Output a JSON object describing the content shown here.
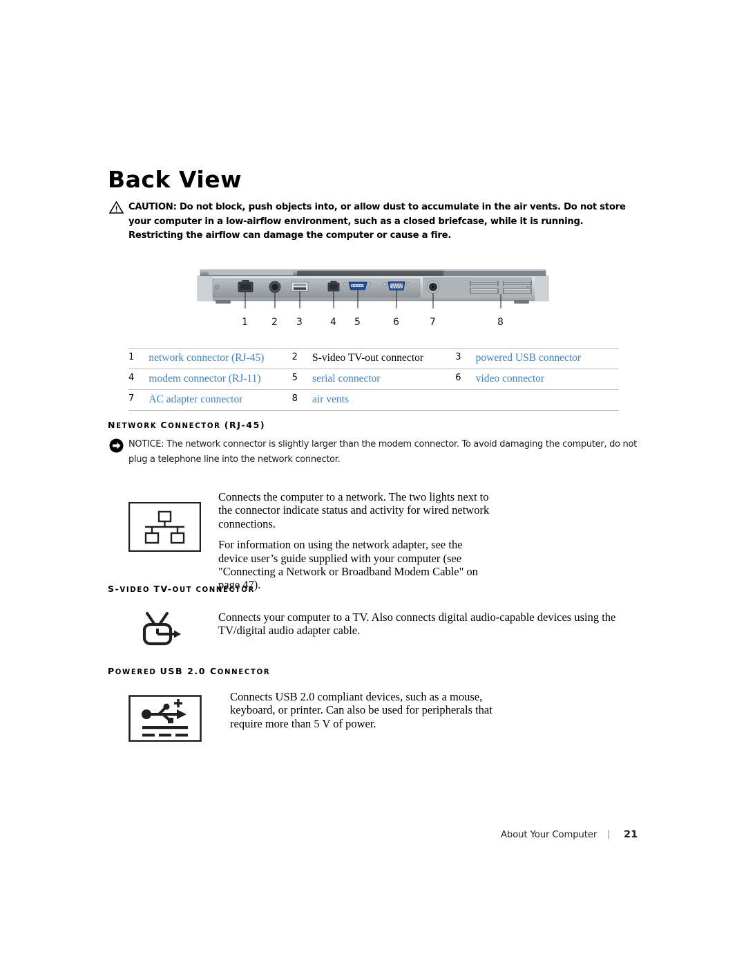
{
  "page": {
    "title": "Back View",
    "footer_section": "About Your Computer",
    "footer_separator": "|",
    "footer_page_number": "21"
  },
  "caution": {
    "icon": "warning-triangle-icon",
    "label": "CAUTION:",
    "text": "CAUTION: Do not block, push objects into, or allow dust to accumulate in the air vents. Do not store your computer in a low-airflow environment, such as a closed briefcase, while it is running. Restricting the airflow can damage the computer or cause a fire."
  },
  "illustration": {
    "name": "laptop-back-panel-photo",
    "callout_numbers": [
      "1",
      "2",
      "3",
      "4",
      "5",
      "6",
      "7",
      "8"
    ],
    "ports": [
      {
        "number": "1",
        "name": "network-port-rj45"
      },
      {
        "number": "2",
        "name": "s-video-port"
      },
      {
        "number": "3",
        "name": "usb-port"
      },
      {
        "number": "4",
        "name": "modem-port-rj11"
      },
      {
        "number": "5",
        "name": "serial-port-db9"
      },
      {
        "number": "6",
        "name": "video-port-vga"
      },
      {
        "number": "7",
        "name": "ac-adapter-jack"
      },
      {
        "number": "8",
        "name": "air-vents-grille"
      }
    ]
  },
  "legend": {
    "rows": [
      [
        {
          "num": "1",
          "label": "network connector (RJ-45)",
          "link": true
        },
        {
          "num": "2",
          "label": "S-video TV-out connector",
          "link": false
        },
        {
          "num": "3",
          "label": "powered USB connector",
          "link": true
        }
      ],
      [
        {
          "num": "4",
          "label": "modem connector (RJ-11)",
          "link": true
        },
        {
          "num": "5",
          "label": "serial connector",
          "link": true
        },
        {
          "num": "6",
          "label": "video connector",
          "link": true
        }
      ],
      [
        {
          "num": "7",
          "label": "AC adapter connector",
          "link": true
        },
        {
          "num": "8",
          "label": "air vents",
          "link": true
        },
        {
          "num": "",
          "label": "",
          "link": false
        }
      ]
    ],
    "link_color": "#3c82d2"
  },
  "sections": [
    {
      "heading_parts": [
        {
          "text": "N",
          "big": true
        },
        {
          "text": "ETWORK ",
          "big": false
        },
        {
          "text": "C",
          "big": true
        },
        {
          "text": "ONNECTOR ",
          "big": false
        },
        {
          "text": "(RJ-45)",
          "big": true
        }
      ],
      "heading_plain": "NETWORK CONNECTOR (RJ-45)",
      "icon": "network-topology-icon",
      "paragraphs": [
        "Connects the computer to a network. The two lights next to the connector indicate status and activity for wired network connections.",
        "For information on using the network adapter, see the device user’s guide supplied with your computer (see \"Connecting a Network or Broadband Modem Cable\" on page 47)."
      ]
    },
    {
      "heading_parts": [
        {
          "text": "S-",
          "big": true
        },
        {
          "text": "VIDEO ",
          "big": false
        },
        {
          "text": "TV-",
          "big": true
        },
        {
          "text": "OUT ",
          "big": false
        },
        {
          "text": "CONNECTOR",
          "big": false
        }
      ],
      "heading_plain": "S-VIDEO TV-OUT CONNECTOR",
      "icon": "tv-out-icon",
      "paragraphs": [
        "Connects your computer to a TV. Also connects digital audio-capable devices using the TV/digital audio adapter cable."
      ]
    },
    {
      "heading_parts": [
        {
          "text": "P",
          "big": true
        },
        {
          "text": "OWERED ",
          "big": false
        },
        {
          "text": "USB 2.0 ",
          "big": true
        },
        {
          "text": "C",
          "big": true
        },
        {
          "text": "ONNECTOR",
          "big": false
        }
      ],
      "heading_plain": "POWERED USB 2.0 CONNECTOR",
      "icon": "usb-powered-icon",
      "paragraphs": [
        "Connects USB 2.0 compliant devices, such as a mouse, keyboard, or printer. Can also be used for peripherals that require more than 5 V of power."
      ]
    }
  ],
  "notice": {
    "icon": "notice-arrow-icon",
    "label": "NOTICE:",
    "text": "NOTICE: The network connector is slightly larger than the modem connector. To avoid damaging the computer, do not plug a telephone line into the network connector."
  }
}
